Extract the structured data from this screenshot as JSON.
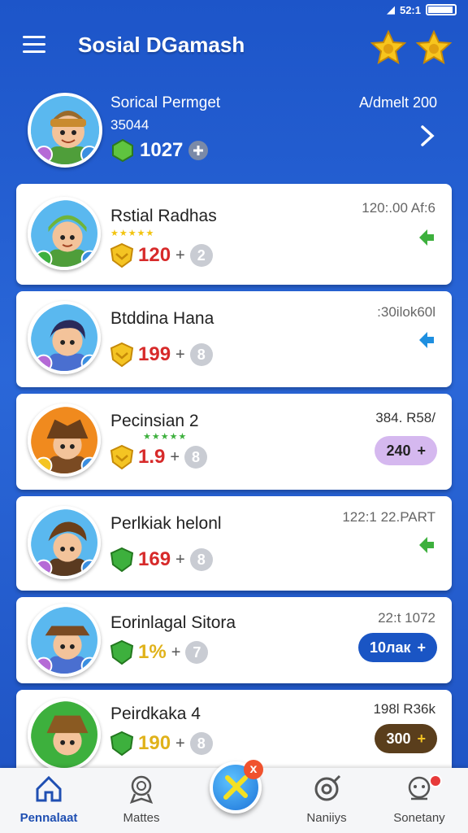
{
  "status_bar": {
    "time": "52:1"
  },
  "header": {
    "title": "Sosial DGamash"
  },
  "profile": {
    "name": "Sorical Permget",
    "id": "35044",
    "score": "1027",
    "status": "A/dmelt 200"
  },
  "players": [
    {
      "name": "Rstial Radhas",
      "time": "120:.00 Af:6",
      "score": "120",
      "rank": "2",
      "stars": "★★★★★",
      "score_color": "#d72a2a",
      "badge_color": "#f4c423",
      "avatar_bg": "#5ab8ef",
      "action": {
        "type": "arrow",
        "color": "#3db03d"
      }
    },
    {
      "name": "Btddina Hana",
      "time": ":30ilok60l",
      "score": "199",
      "rank": "8",
      "stars": "",
      "score_color": "#d72a2a",
      "badge_color": "#f4c423",
      "avatar_bg": "#5ab8ef",
      "action": {
        "type": "arrow",
        "color": "#1e8fe0"
      }
    },
    {
      "name": "Pecinsian 2",
      "time": "384. R58/",
      "score": "1.9",
      "rank": "8",
      "stars": "★★★★★",
      "score_color": "#d72a2a",
      "badge_color": "#f4c423",
      "avatar_bg": "#f08a1e",
      "action": {
        "type": "pill",
        "label": "240",
        "bg": "#d5b8ef",
        "color": "#222"
      }
    },
    {
      "name": "Perlkiak helonl",
      "time": "122:1 22.PART",
      "score": "169",
      "rank": "8",
      "stars": "",
      "score_color": "#d72a2a",
      "badge_color": "#3db03d",
      "avatar_bg": "#5ab8ef",
      "action": {
        "type": "arrow",
        "color": "#3db03d"
      }
    },
    {
      "name": "Eorinlagal Sitora",
      "time": "22:t 1072",
      "score": "1%",
      "rank": "7",
      "stars": "",
      "score_color": "#e0b21a",
      "badge_color": "#3db03d",
      "avatar_bg": "#5ab8ef",
      "action": {
        "type": "pill",
        "label": "10лак",
        "bg": "#1a55c4",
        "color": "#fff"
      }
    },
    {
      "name": "Peirdkaka 4",
      "time": "198l R36k",
      "score": "190",
      "rank": "8",
      "stars": "",
      "score_color": "#e0b21a",
      "badge_color": "#3db03d",
      "avatar_bg": "#3db03d",
      "action": {
        "type": "pill",
        "label": "300",
        "bg": "#5a3e1c",
        "color": "#fff"
      }
    }
  ],
  "nav": {
    "items": [
      {
        "label": "Pennalaat",
        "icon": "home-icon",
        "active": true
      },
      {
        "label": "Mattes",
        "icon": "medal-icon",
        "active": false
      },
      {
        "label": "Naniiys",
        "icon": "target-icon",
        "active": false
      },
      {
        "label": "Sonetany",
        "icon": "mascot-icon",
        "active": false
      }
    ],
    "fab_badge": "x"
  }
}
